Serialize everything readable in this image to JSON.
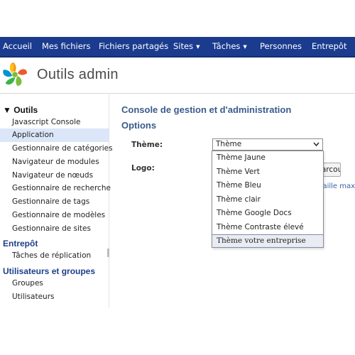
{
  "nav": {
    "items": [
      {
        "label": "Accueil",
        "dropdown": false
      },
      {
        "label": "Mes fichiers",
        "dropdown": false
      },
      {
        "label": "Fichiers partagés",
        "dropdown": false
      },
      {
        "label": "Sites",
        "dropdown": true
      },
      {
        "label": "Tâches",
        "dropdown": true
      },
      {
        "label": "Personnes",
        "dropdown": false
      },
      {
        "label": "Entrepôt",
        "dropdown": false
      }
    ],
    "caret": "▼"
  },
  "header": {
    "title": "Outils admin",
    "logo_icon": "alfresco-flower-logo"
  },
  "sidebar": {
    "tools_heading": "▼ Outils",
    "tools": [
      {
        "label": "Javascript Console",
        "active": false
      },
      {
        "label": "Application",
        "active": true
      },
      {
        "label": "Gestionnaire de catégories",
        "active": false
      },
      {
        "label": "Navigateur de modules",
        "active": false
      },
      {
        "label": "Navigateur de nœuds",
        "active": false
      },
      {
        "label": "Gestionnaire de recherche",
        "active": false
      },
      {
        "label": "Gestionnaire de tags",
        "active": false
      },
      {
        "label": "Gestionnaire de modèles",
        "active": false
      },
      {
        "label": "Gestionnaire de sites",
        "active": false
      }
    ],
    "repo_heading": "Entrepôt",
    "repo": [
      {
        "label": "Tâches de réplication"
      }
    ],
    "users_heading": "Utilisateurs et groupes",
    "users": [
      {
        "label": "Groupes"
      },
      {
        "label": "Utilisateurs"
      }
    ]
  },
  "main": {
    "title": "Console de gestion et d'administration",
    "options_title": "Options",
    "theme_label": "Thème:",
    "theme_value": "Thème",
    "logo_label": "Logo:",
    "browse_label": "Parcourir",
    "hint_text": "Taille maximale recommandée"
  },
  "theme_dropdown": {
    "options": [
      {
        "label": "Thème Jaune",
        "hover": false
      },
      {
        "label": "Thème Vert",
        "hover": false
      },
      {
        "label": "Thème Bleu",
        "hover": false
      },
      {
        "label": "Thème clair",
        "hover": false
      },
      {
        "label": "Thème Google Docs",
        "hover": false
      },
      {
        "label": "Thème Contraste élevé",
        "hover": false
      },
      {
        "label": "Thème votre entreprise",
        "hover": true
      }
    ]
  },
  "colors": {
    "nav_bg": "#1b3b8f",
    "active_item_bg": "#dbe7f8",
    "heading_blue": "#3b5b8c"
  }
}
